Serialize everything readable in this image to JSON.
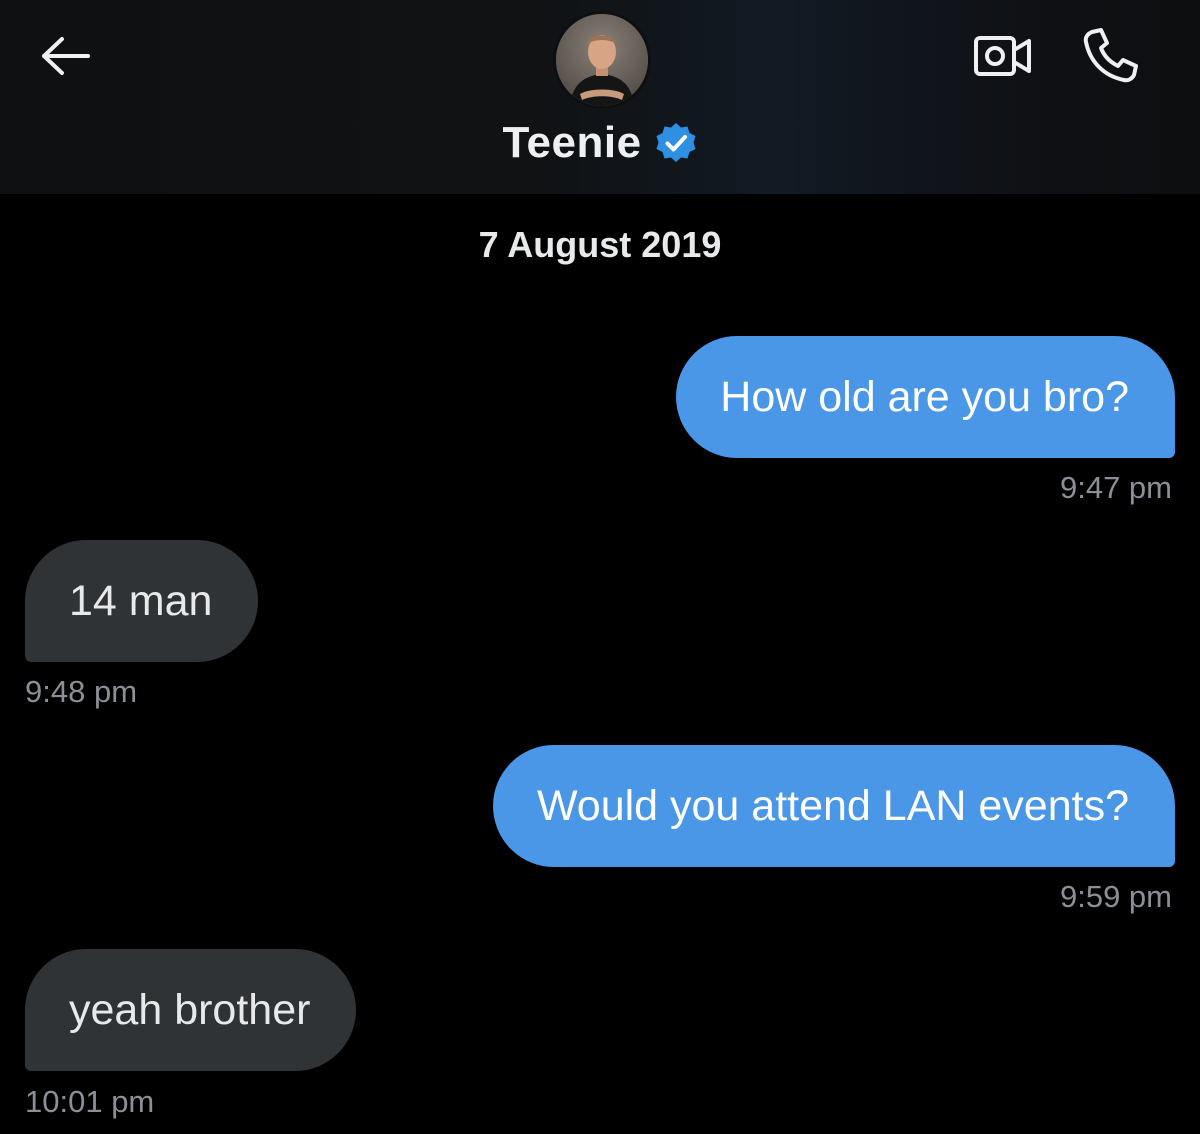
{
  "header": {
    "contact_name": "Teenie",
    "verified": true,
    "accent_color": "#1d9bf0",
    "icons": {
      "back": "arrow-left-icon",
      "video": "video-camera-icon",
      "call": "phone-icon",
      "verified": "verified-badge-icon"
    }
  },
  "conversation": {
    "date": "7 August 2019",
    "messages": [
      {
        "direction": "outgoing",
        "text": "How old are you bro?",
        "time": "9:47 pm"
      },
      {
        "direction": "incoming",
        "text": "14 man",
        "time": "9:48 pm"
      },
      {
        "direction": "outgoing",
        "text": "Would you attend LAN events?",
        "time": "9:59 pm"
      },
      {
        "direction": "incoming",
        "text": "yeah brother",
        "time": "10:01 pm"
      }
    ]
  },
  "colors": {
    "background": "#000000",
    "outgoing_bubble": "#4a97e7",
    "incoming_bubble": "#2f3336",
    "timestamp": "#8b9096"
  }
}
